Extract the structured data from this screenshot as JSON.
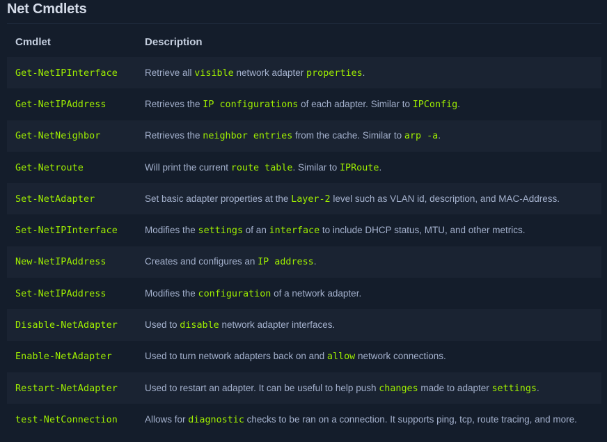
{
  "heading": "Net Cmdlets",
  "table": {
    "headers": [
      "Cmdlet",
      "Description"
    ],
    "rows": [
      {
        "cmdlet": "Get-NetIPInterface",
        "description": [
          {
            "t": "Retrieve all ",
            "code": false
          },
          {
            "t": "visible",
            "code": true
          },
          {
            "t": " network adapter ",
            "code": false
          },
          {
            "t": "properties",
            "code": true
          },
          {
            "t": ".",
            "code": false
          }
        ]
      },
      {
        "cmdlet": "Get-NetIPAddress",
        "description": [
          {
            "t": "Retrieves the ",
            "code": false
          },
          {
            "t": "IP configurations",
            "code": true
          },
          {
            "t": " of each adapter. Similar to ",
            "code": false
          },
          {
            "t": "IPConfig",
            "code": true
          },
          {
            "t": ".",
            "code": false
          }
        ]
      },
      {
        "cmdlet": "Get-NetNeighbor",
        "description": [
          {
            "t": "Retrieves the ",
            "code": false
          },
          {
            "t": "neighbor entries",
            "code": true
          },
          {
            "t": " from the cache. Similar to ",
            "code": false
          },
          {
            "t": "arp -a",
            "code": true
          },
          {
            "t": ".",
            "code": false
          }
        ]
      },
      {
        "cmdlet": "Get-Netroute",
        "description": [
          {
            "t": "Will print the current ",
            "code": false
          },
          {
            "t": "route table",
            "code": true
          },
          {
            "t": ". Similar to ",
            "code": false
          },
          {
            "t": "IPRoute",
            "code": true
          },
          {
            "t": ".",
            "code": false
          }
        ]
      },
      {
        "cmdlet": "Set-NetAdapter",
        "description": [
          {
            "t": "Set basic adapter properties at the ",
            "code": false
          },
          {
            "t": "Layer-2",
            "code": true
          },
          {
            "t": " level such as VLAN id, description, and MAC-Address.",
            "code": false
          }
        ]
      },
      {
        "cmdlet": "Set-NetIPInterface",
        "description": [
          {
            "t": "Modifies the ",
            "code": false
          },
          {
            "t": "settings",
            "code": true
          },
          {
            "t": " of an ",
            "code": false
          },
          {
            "t": "interface",
            "code": true
          },
          {
            "t": " to include DHCP status, MTU, and other metrics.",
            "code": false
          }
        ]
      },
      {
        "cmdlet": "New-NetIPAddress",
        "description": [
          {
            "t": "Creates and configures an ",
            "code": false
          },
          {
            "t": "IP address",
            "code": true
          },
          {
            "t": ".",
            "code": false
          }
        ]
      },
      {
        "cmdlet": "Set-NetIPAddress",
        "description": [
          {
            "t": "Modifies the ",
            "code": false
          },
          {
            "t": "configuration",
            "code": true
          },
          {
            "t": " of a network adapter.",
            "code": false
          }
        ]
      },
      {
        "cmdlet": "Disable-NetAdapter",
        "description": [
          {
            "t": "Used to ",
            "code": false
          },
          {
            "t": "disable",
            "code": true
          },
          {
            "t": " network adapter interfaces.",
            "code": false
          }
        ]
      },
      {
        "cmdlet": "Enable-NetAdapter",
        "description": [
          {
            "t": "Used to turn network adapters back on and ",
            "code": false
          },
          {
            "t": "allow",
            "code": true
          },
          {
            "t": " network connections.",
            "code": false
          }
        ]
      },
      {
        "cmdlet": "Restart-NetAdapter",
        "description": [
          {
            "t": "Used to restart an adapter. It can be useful to help push ",
            "code": false
          },
          {
            "t": "changes",
            "code": true
          },
          {
            "t": " made to adapter ",
            "code": false
          },
          {
            "t": "settings",
            "code": true
          },
          {
            "t": ".",
            "code": false
          }
        ]
      },
      {
        "cmdlet": "test-NetConnection",
        "description": [
          {
            "t": "Allows for ",
            "code": false
          },
          {
            "t": "diagnostic",
            "code": true
          },
          {
            "t": " checks to be ran on a connection. It supports ping, tcp, route tracing, and more.",
            "code": false
          }
        ]
      }
    ]
  },
  "colors": {
    "background": "#141d2b",
    "stripe": "#1a2332",
    "accent": "#9fef00",
    "text": "#a4b1cd",
    "heading": "#d4dbe8"
  }
}
